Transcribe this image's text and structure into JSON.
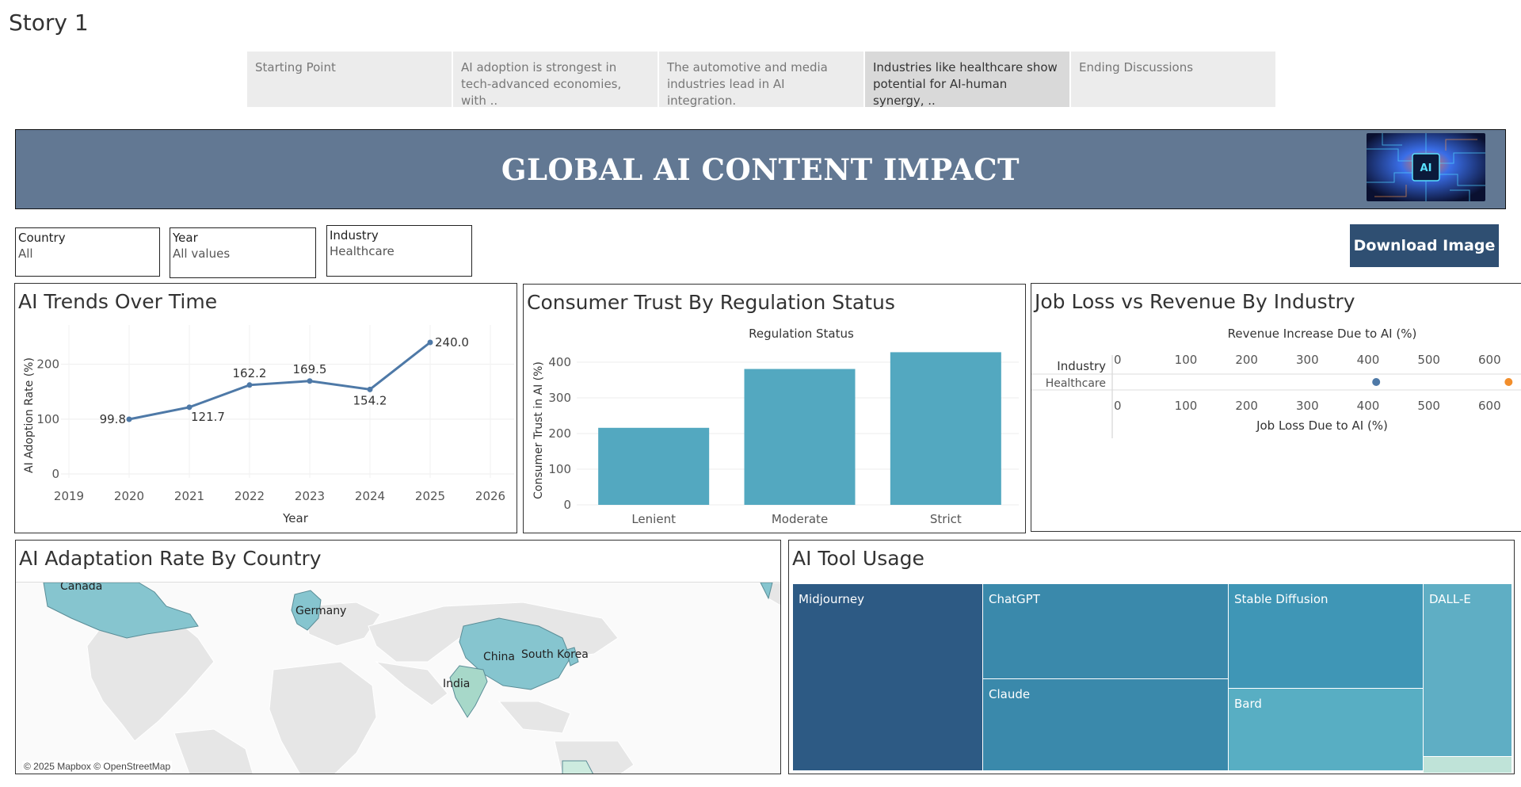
{
  "story": {
    "title": "Story 1",
    "tabs": [
      {
        "label": "Starting Point",
        "active": false
      },
      {
        "label": "AI adoption is strongest in tech-advanced economies, with ..",
        "active": false
      },
      {
        "label": " The automotive and media industries lead in AI integration.",
        "active": false
      },
      {
        "label": " Industries like healthcare show potential for AI-human synergy, ..",
        "active": true
      },
      {
        "label": "Ending Discussions",
        "active": false
      }
    ]
  },
  "banner": {
    "title": "GLOBAL AI CONTENT IMPACT",
    "image_icon": "ai-chip-image"
  },
  "filters": [
    {
      "label": "Country",
      "value": "All"
    },
    {
      "label": "Year",
      "value": "All values"
    },
    {
      "label": "Industry",
      "value": "Healthcare"
    }
  ],
  "download_label": "Download Image",
  "panels": {
    "trends": "AI Trends Over Time",
    "trust": "Consumer Trust By Regulation Status",
    "jobloss": "Job Loss vs Revenue By Industry",
    "map": "AI Adaptation Rate By Country",
    "tools": "AI Tool Usage"
  },
  "colors": {
    "line": "#4e79a7",
    "bar": "#53a8c0",
    "banner": "#627893",
    "button": "#2f4f72",
    "map_land": "#86c5cf",
    "dot_blue": "#4e79a7",
    "dot_orange": "#f28e2b"
  },
  "chart_data": [
    {
      "type": "line",
      "title": "AI Trends Over Time",
      "xlabel": "Year",
      "ylabel": "AI Adoption Rate (%)",
      "x": [
        2020,
        2021,
        2022,
        2023,
        2024,
        2025
      ],
      "values": [
        99.8,
        121.7,
        162.2,
        169.5,
        154.2,
        240.0
      ],
      "labels": [
        "99.8",
        "121.7",
        "162.2",
        "169.5",
        "154.2",
        "240.0"
      ],
      "xticks": [
        "2019",
        "2020",
        "2021",
        "2022",
        "2023",
        "2024",
        "2025",
        "2026"
      ],
      "yticks": [
        "0",
        "100",
        "200"
      ],
      "xlim": [
        2019,
        2026
      ],
      "ylim": [
        0,
        240
      ]
    },
    {
      "type": "bar",
      "title": "Consumer Trust By Regulation Status",
      "header": "Regulation Status",
      "categories": [
        "Lenient",
        "Moderate",
        "Strict"
      ],
      "values": [
        216,
        381,
        428
      ],
      "ylabel": "Consumer Trust in AI (%)",
      "yticks": [
        "0",
        "100",
        "200",
        "300",
        "400"
      ],
      "ylim": [
        0,
        440
      ]
    },
    {
      "type": "scatter",
      "title": "Job Loss vs Revenue By Industry",
      "row_header": "Industry",
      "rows": [
        "Healthcare"
      ],
      "top_axis_label": "Revenue Increase Due to AI (%)",
      "bottom_axis_label": "Job Loss Due to AI (%)",
      "ticks": [
        "0",
        "100",
        "200",
        "300",
        "400",
        "500",
        "600"
      ],
      "xlim": [
        0,
        660
      ],
      "series": [
        {
          "name": "Revenue Increase Due to AI (%)",
          "values": [
            432
          ],
          "color": "#4e79a7"
        },
        {
          "name": "Job Loss Due to AI (%)",
          "values": [
            650
          ],
          "color": "#f28e2b"
        }
      ]
    }
  ],
  "map": {
    "labels": [
      "Canada",
      "Germany",
      "China",
      "South Korea",
      "India"
    ],
    "attribution": "© 2025 Mapbox © OpenStreetMap"
  },
  "treemap": {
    "items": [
      {
        "label": "Midjourney",
        "color": "#2d5a84"
      },
      {
        "label": "ChatGPT",
        "color": "#3a89ab"
      },
      {
        "label": "Claude",
        "color": "#3a89ab"
      },
      {
        "label": "Stable Diffusion",
        "color": "#3f96b6"
      },
      {
        "label": "Bard",
        "color": "#58aec3"
      },
      {
        "label": "DALL-E",
        "color": "#5faec4"
      },
      {
        "label": "",
        "color": "#bfe3d8"
      }
    ]
  }
}
